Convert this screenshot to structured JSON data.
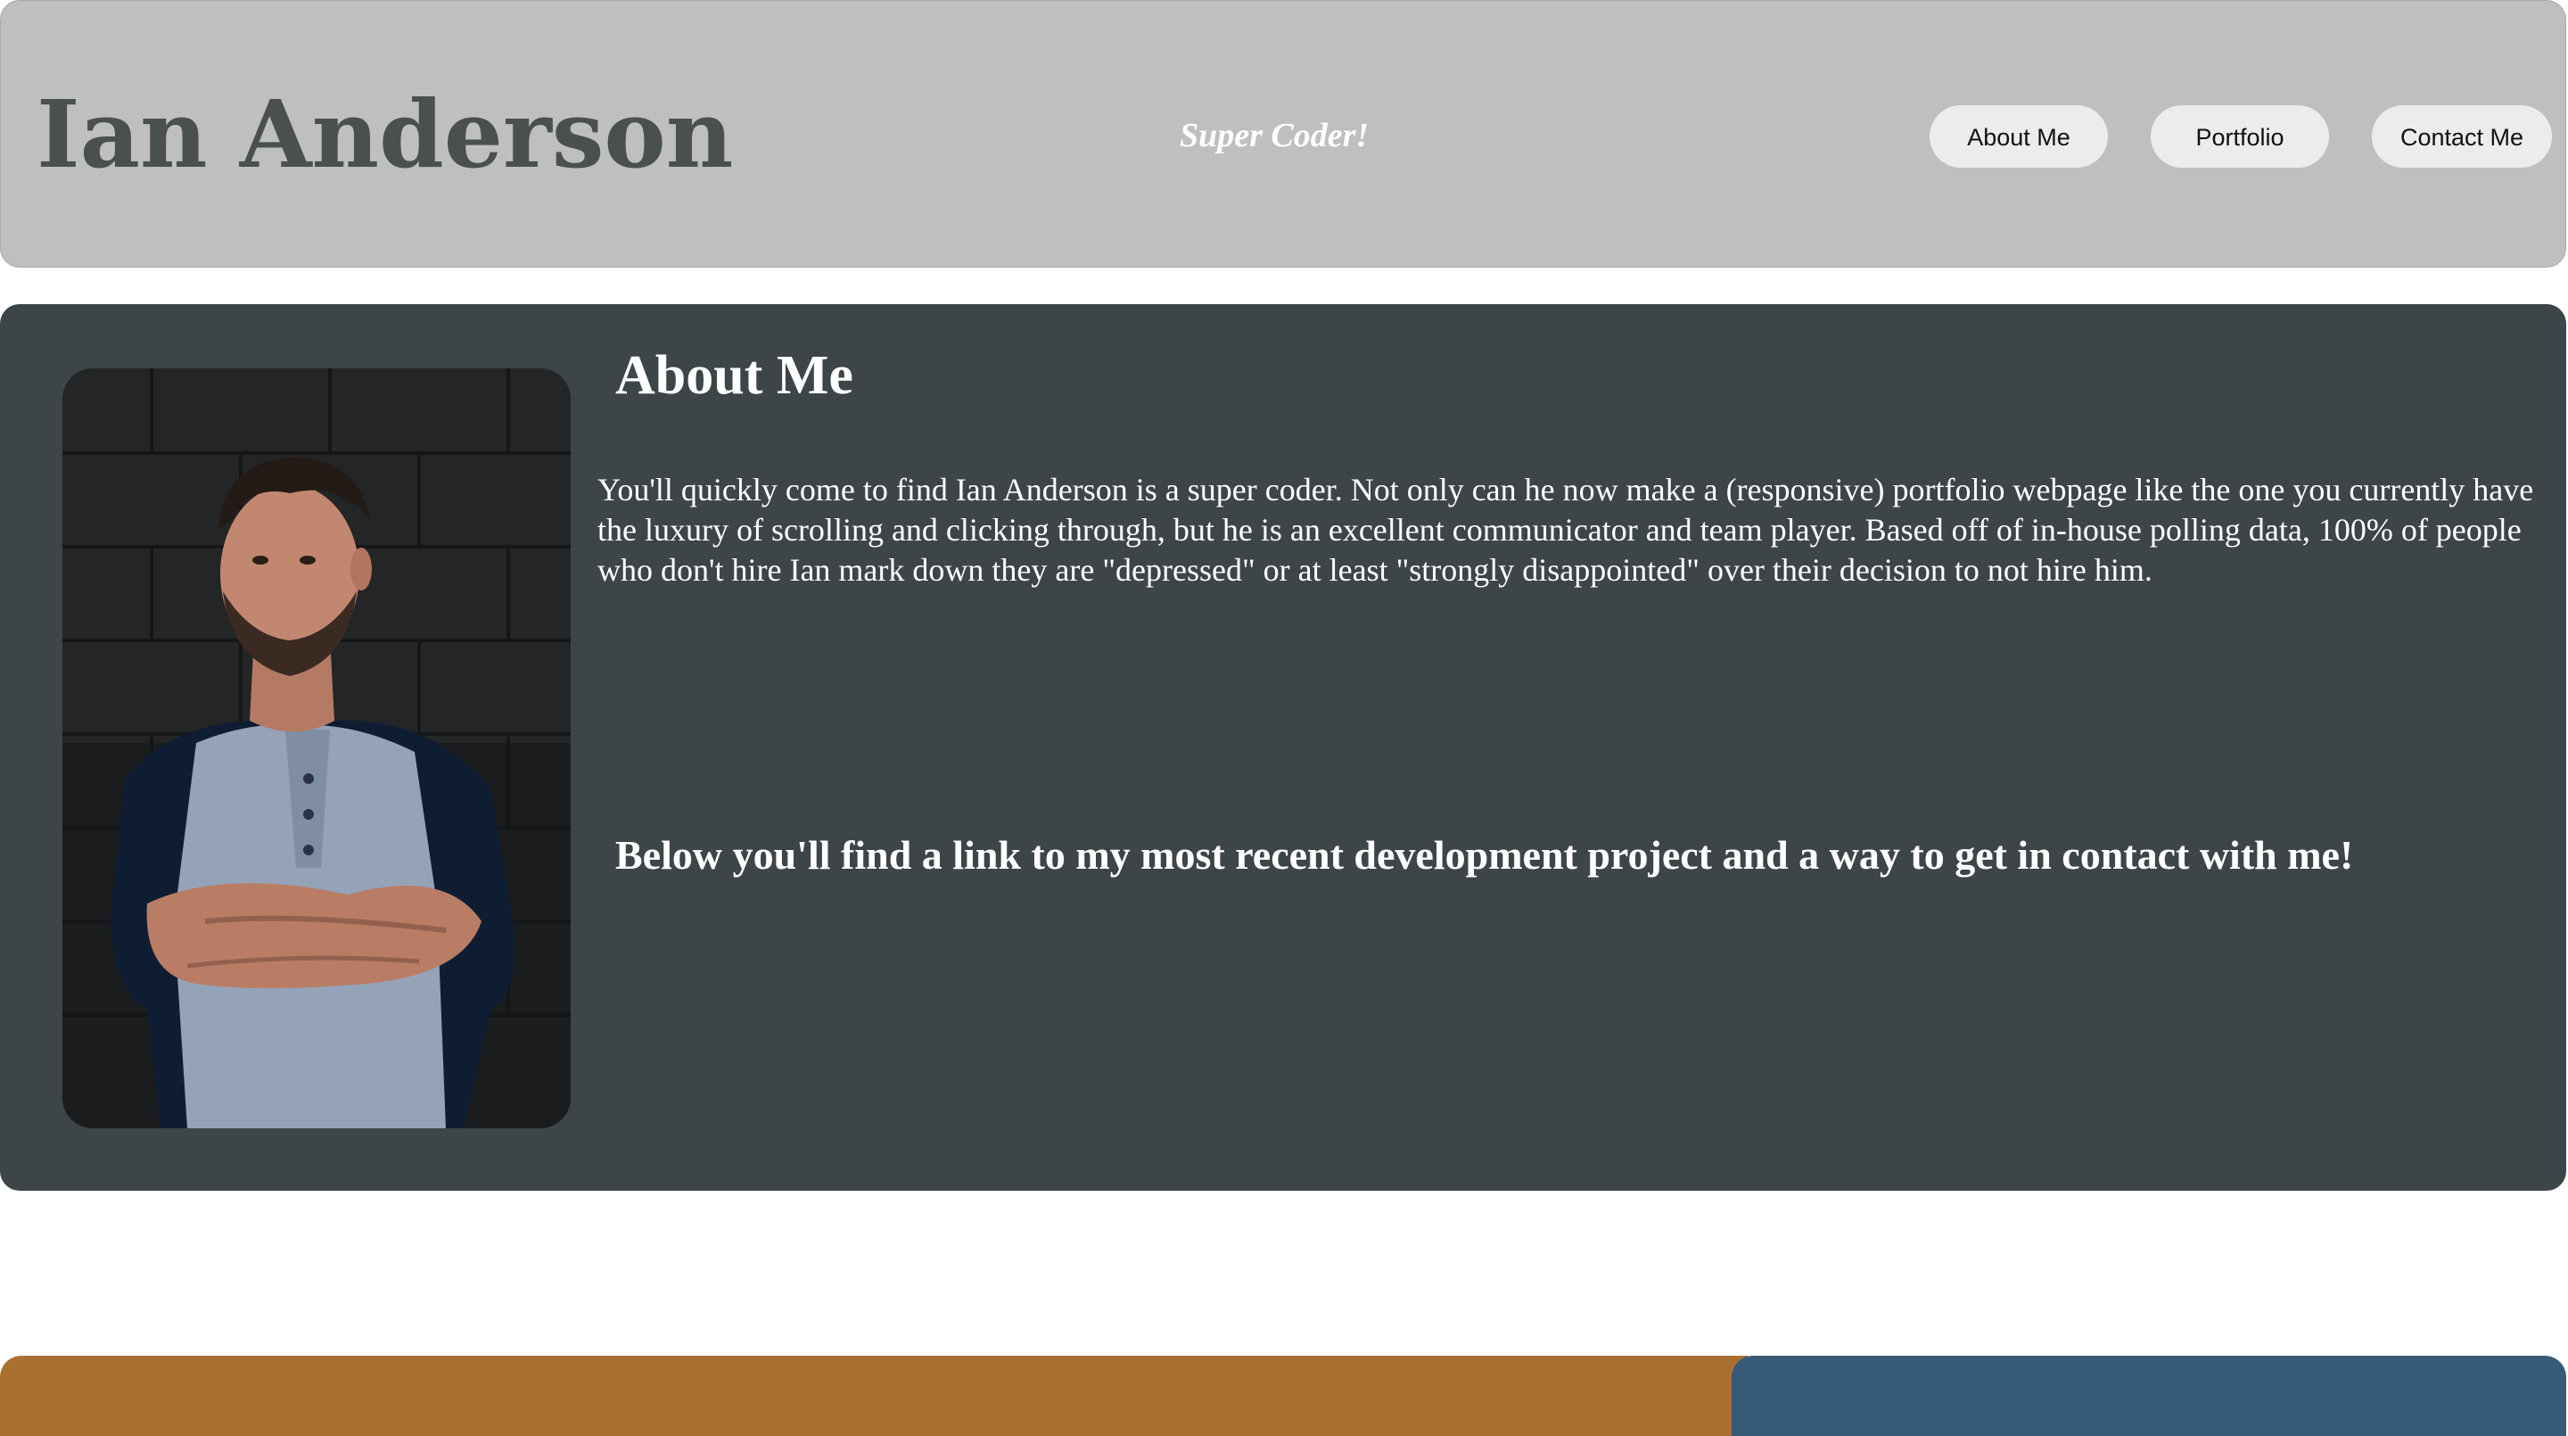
{
  "header": {
    "title": "Ian Anderson",
    "tagline": "Super Coder!",
    "nav": {
      "about": "About Me",
      "portfolio": "Portfolio",
      "contact": "Contact Me"
    }
  },
  "about": {
    "heading": "About Me",
    "body": "You'll quickly come to find Ian Anderson is a super coder. Not only can he now make a (responsive) portfolio webpage like the one you currently have the luxury of scrolling and clicking through, but he is an excellent communicator and team player. Based off of in-house polling data, 100% of people who don't hire Ian mark down they are \"depressed\" or at least \"strongly disappointed\" over their decision to not hire him.",
    "subheading": "Below you'll find a link to my most recent development project and a way to get in contact with me!"
  },
  "colors": {
    "header_bg": "#bfbfbf",
    "title": "#4a5050",
    "about_bg": "#3e4548",
    "button_bg": "#ececec",
    "bottom_left": "#a97131",
    "bottom_right": "#375a77"
  }
}
